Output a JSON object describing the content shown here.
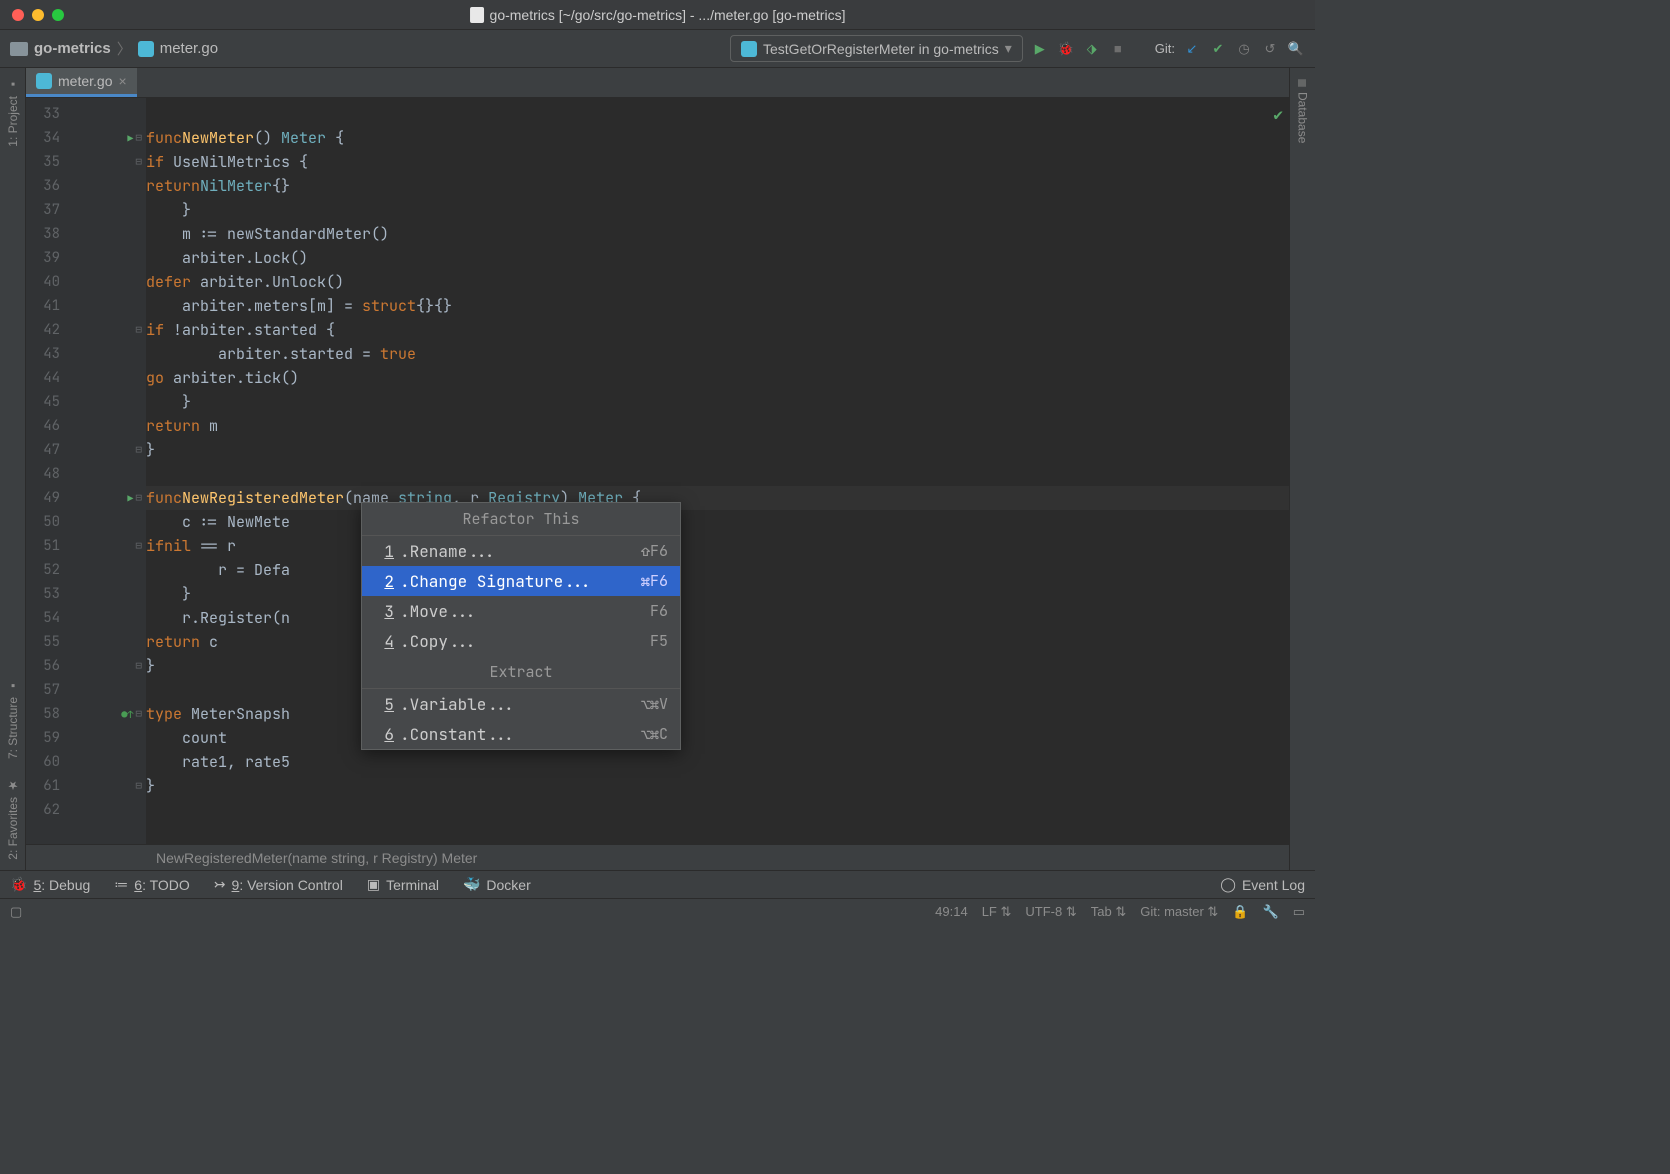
{
  "titlebar": {
    "title": "go-metrics [~/go/src/go-metrics] - .../meter.go [go-metrics]"
  },
  "breadcrumb": {
    "root": "go-metrics",
    "file": "meter.go"
  },
  "run_config": {
    "label": "TestGetOrRegisterMeter in go-metrics"
  },
  "git_label": "Git:",
  "tab": {
    "label": "meter.go"
  },
  "sidebar_left": {
    "project": "1: Project",
    "structure": "7: Structure",
    "favorites": "2: Favorites"
  },
  "sidebar_right": {
    "database": "Database"
  },
  "code": {
    "lines": [
      {
        "n": 33,
        "html": ""
      },
      {
        "n": 34,
        "html": "<span class='kw'>func</span> <span class='fn'>NewMeter</span>() <span class='type'>Meter</span> {"
      },
      {
        "n": 35,
        "html": "    <span class='kw'>if</span> UseNilMetrics {"
      },
      {
        "n": 36,
        "html": "        <span class='kw'>return</span> <span class='type'>NilMeter</span>{}"
      },
      {
        "n": 37,
        "html": "    }"
      },
      {
        "n": 38,
        "html": "    m := newStandardMeter()"
      },
      {
        "n": 39,
        "html": "    arbiter.Lock()"
      },
      {
        "n": 40,
        "html": "    <span class='kw'>defer</span> arbiter.Unlock()"
      },
      {
        "n": 41,
        "html": "    arbiter.meters[m] = <span class='kw'>struct</span>{}{}"
      },
      {
        "n": 42,
        "html": "    <span class='kw'>if</span> !arbiter.started {"
      },
      {
        "n": 43,
        "html": "        arbiter.started = <span class='lit'>true</span>"
      },
      {
        "n": 44,
        "html": "        <span class='kw'>go</span> arbiter.tick()"
      },
      {
        "n": 45,
        "html": "    }"
      },
      {
        "n": 46,
        "html": "    <span class='kw'>return</span> m"
      },
      {
        "n": 47,
        "html": "}"
      },
      {
        "n": 48,
        "html": ""
      },
      {
        "n": 49,
        "html": "<span class='kw'>func</span> <span class='fn'>NewRegisteredMeter</span>(name <span class='type'>string</span>, r <span class='type'>Registry</span>) <span class='type'>Meter</span> {",
        "hl": true
      },
      {
        "n": 50,
        "html": "    c := NewMete"
      },
      {
        "n": 51,
        "html": "    <span class='kw'>if</span> <span class='lit'>nil</span> == r"
      },
      {
        "n": 52,
        "html": "        r = Defa"
      },
      {
        "n": 53,
        "html": "    }"
      },
      {
        "n": 54,
        "html": "    r.Register(n"
      },
      {
        "n": 55,
        "html": "    <span class='kw'>return</span> c"
      },
      {
        "n": 56,
        "html": "}"
      },
      {
        "n": 57,
        "html": ""
      },
      {
        "n": 58,
        "html": "<span class='kw'>type</span> MeterSnapsh"
      },
      {
        "n": 59,
        "html": "    count"
      },
      {
        "n": 60,
        "html": "    rate1, rate5"
      },
      {
        "n": 61,
        "html": "}"
      },
      {
        "n": 62,
        "html": ""
      }
    ]
  },
  "breadcrumb_bottom": "NewRegisteredMeter(name string, r Registry) Meter",
  "popup": {
    "title": "Refactor This",
    "items": [
      {
        "n": "1",
        "label": "Rename...",
        "shortcut": "⇧F6"
      },
      {
        "n": "2",
        "label": "Change Signature...",
        "shortcut": "⌘F6",
        "selected": true
      },
      {
        "n": "3",
        "label": "Move...",
        "shortcut": "F6"
      },
      {
        "n": "4",
        "label": "Copy...",
        "shortcut": "F5"
      }
    ],
    "section2": "Extract",
    "items2": [
      {
        "n": "5",
        "label": "Variable...",
        "shortcut": "⌥⌘V"
      },
      {
        "n": "6",
        "label": "Constant...",
        "shortcut": "⌥⌘C"
      }
    ]
  },
  "bottom_tools": {
    "debug": "5: Debug",
    "todo": "6: TODO",
    "vcs": "9: Version Control",
    "terminal": "Terminal",
    "docker": "Docker",
    "event_log": "Event Log"
  },
  "status": {
    "pos": "49:14",
    "line_sep": "LF",
    "encoding": "UTF-8",
    "indent": "Tab",
    "git": "Git: master",
    "lock": "🔓"
  }
}
